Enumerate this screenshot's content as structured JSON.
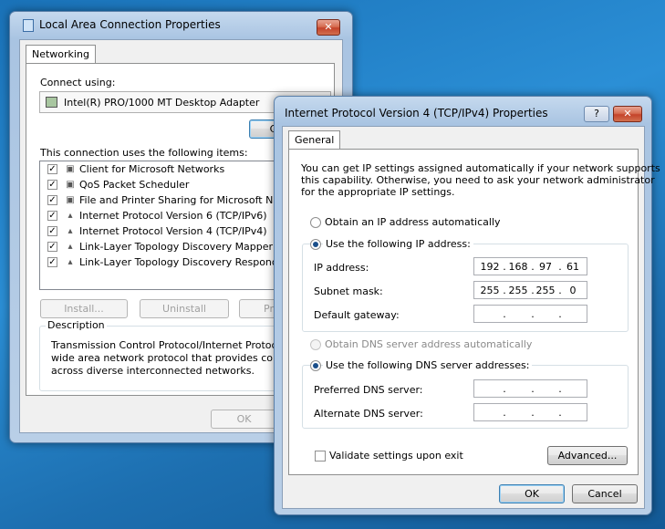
{
  "lac": {
    "title": "Local Area Connection Properties",
    "tab": "Networking",
    "connect_using_label": "Connect using:",
    "adapter": "Intel(R) PRO/1000 MT Desktop Adapter",
    "configure_label": "Co",
    "items_label": "This connection uses the following items:",
    "items": [
      {
        "label": "Client for Microsoft Networks",
        "checked": true
      },
      {
        "label": "QoS Packet Scheduler",
        "checked": true
      },
      {
        "label": "File and Printer Sharing for Microsoft Networks",
        "checked": true
      },
      {
        "label": "Internet Protocol Version 6 (TCP/IPv6)",
        "checked": true
      },
      {
        "label": "Internet Protocol Version 4 (TCP/IPv4)",
        "checked": true
      },
      {
        "label": "Link-Layer Topology Discovery Mapper I/O Dr",
        "checked": true
      },
      {
        "label": "Link-Layer Topology Discovery Responder",
        "checked": true
      }
    ],
    "install_label": "Install...",
    "uninstall_label": "Uninstall",
    "properties_label": "Pro",
    "description_title": "Description",
    "description_lines": [
      "Transmission Control Protocol/Internet Protocol. The",
      "wide area network protocol that provides communica",
      "across diverse interconnected networks."
    ],
    "ok_label": "OK"
  },
  "ipv4": {
    "title": "Internet Protocol Version 4 (TCP/IPv4) Properties",
    "help_label": "?",
    "close_label": "✕",
    "tab": "General",
    "intro_lines": [
      "You can get IP settings assigned automatically if your network supports",
      "this capability. Otherwise, you need to ask your network administrator",
      "for the appropriate IP settings."
    ],
    "obtain_ip_auto": "Obtain an IP address automatically",
    "use_following_ip": "Use the following IP address:",
    "ip_address_label": "IP address:",
    "ip_address": [
      "192",
      "168",
      "97",
      "61"
    ],
    "subnet_label": "Subnet mask:",
    "subnet": [
      "255",
      "255",
      "255",
      "0"
    ],
    "gateway_label": "Default gateway:",
    "obtain_dns_auto": "Obtain DNS server address automatically",
    "use_following_dns": "Use the following DNS server addresses:",
    "preferred_dns_label": "Preferred DNS server:",
    "alternate_dns_label": "Alternate DNS server:",
    "validate_label": "Validate settings upon exit",
    "advanced_label": "Advanced...",
    "ok_label": "OK",
    "cancel_label": "Cancel",
    "dot": "."
  }
}
